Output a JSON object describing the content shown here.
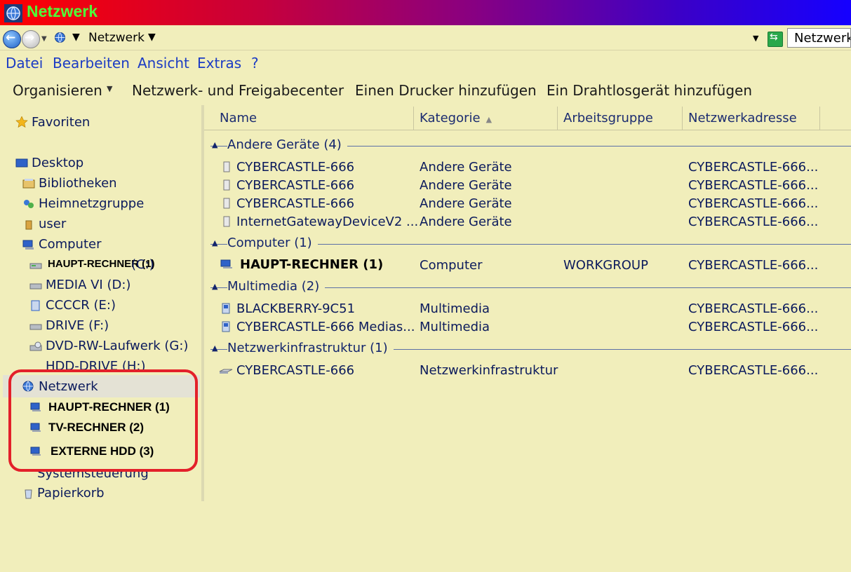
{
  "window": {
    "title": "Netzwerk"
  },
  "address": {
    "location": "Netzwerk",
    "search_value": "Netzwerk"
  },
  "menu": [
    "Datei",
    "Bearbeiten",
    "Ansicht",
    "Extras",
    "?"
  ],
  "toolbar": {
    "organize": "Organisieren",
    "network_center": "Netzwerk- und Freigabecenter",
    "add_printer": "Einen Drucker hinzufügen",
    "add_wireless": "Ein Drahtlosgerät hinzufügen"
  },
  "nav": {
    "favorites": "Favoriten",
    "desktop": "Desktop",
    "libraries": "Bibliotheken",
    "homegroup": "Heimnetzgruppe",
    "user": "user",
    "computer": "Computer",
    "drives": [
      {
        "label": "HAUPT-RECHNER (1)",
        "letter": "(C:)"
      },
      {
        "label": "MEDIA VI (D:)"
      },
      {
        "label": "CCCCR (E:)"
      },
      {
        "label": "DRIVE (F:)"
      },
      {
        "label": "DVD-RW-Laufwerk (G:)"
      },
      {
        "label": "HDD-DRIVE (H:)"
      }
    ],
    "network": "Netzwerk",
    "network_items": [
      "HAUPT-RECHNER (1)",
      "TV-RECHNER (2)",
      "EXTERNE HDD (3)"
    ],
    "control_panel": "Systemsteuerung",
    "recycle_bin": "Papierkorb"
  },
  "columns": [
    "Name",
    "Kategorie",
    "Arbeitsgruppe",
    "Netzwerkadresse"
  ],
  "groups": [
    {
      "label": "Andere Geräte (4)",
      "rows": [
        {
          "name": "CYBERCASTLE-666",
          "category": "Andere Geräte",
          "workgroup": "",
          "address": "CYBERCASTLE-666..."
        },
        {
          "name": "CYBERCASTLE-666",
          "category": "Andere Geräte",
          "workgroup": "",
          "address": "CYBERCASTLE-666..."
        },
        {
          "name": "CYBERCASTLE-666",
          "category": "Andere Geräte",
          "workgroup": "",
          "address": "CYBERCASTLE-666..."
        },
        {
          "name": "InternetGatewayDeviceV2 ...",
          "category": "Andere Geräte",
          "workgroup": "",
          "address": "CYBERCASTLE-666..."
        }
      ]
    },
    {
      "label": "Computer (1)",
      "rows": [
        {
          "name": "HAUPT-RECHNER (1)",
          "category": "Computer",
          "workgroup": "WORKGROUP",
          "address": "CYBERCASTLE-666..."
        }
      ]
    },
    {
      "label": "Multimedia (2)",
      "rows": [
        {
          "name": "BLACKBERRY-9C51",
          "category": "Multimedia",
          "workgroup": "",
          "address": "CYBERCASTLE-666..."
        },
        {
          "name": "CYBERCASTLE-666 Medias...",
          "category": "Multimedia",
          "workgroup": "",
          "address": "CYBERCASTLE-666..."
        }
      ]
    },
    {
      "label": "Netzwerkinfrastruktur (1)",
      "rows": [
        {
          "name": "CYBERCASTLE-666",
          "category": "Netzwerkinfrastruktur",
          "workgroup": "",
          "address": "CYBERCASTLE-666..."
        }
      ]
    }
  ],
  "colors": {
    "accent_red": "#e3202a",
    "title_text": "#4dff3a",
    "link_blue": "#1c3cc4",
    "background": "#f1eebb"
  }
}
